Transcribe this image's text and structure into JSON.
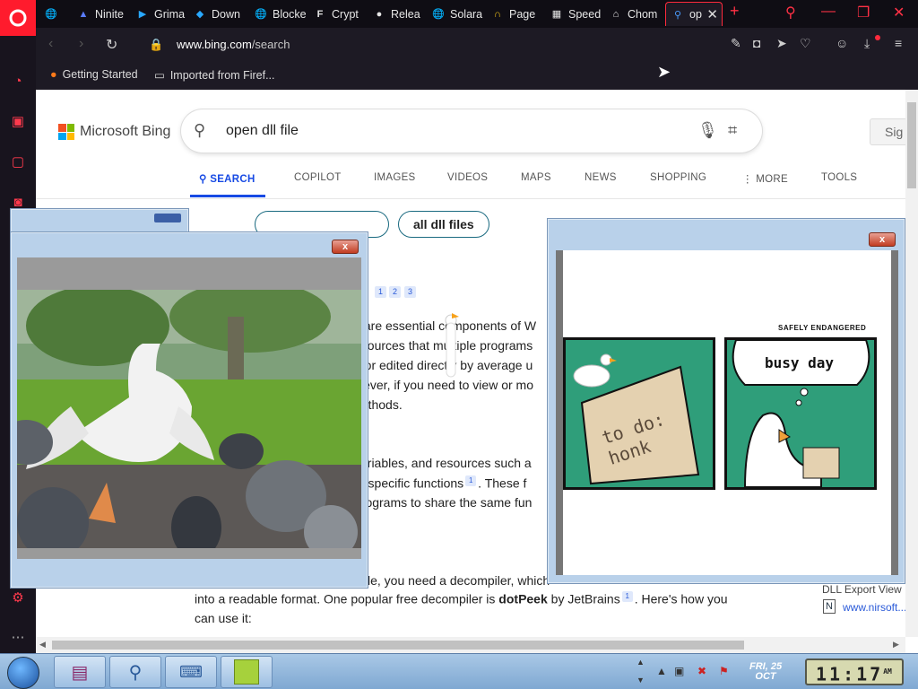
{
  "browser": {
    "tabs": [
      {
        "label": "",
        "icon": "globe-icon"
      },
      {
        "label": "Ninite",
        "icon": "ninite-icon"
      },
      {
        "label": "Grima",
        "icon": "play-icon"
      },
      {
        "label": "Down",
        "icon": "download-icon"
      },
      {
        "label": "Blocke",
        "icon": "globe-icon"
      },
      {
        "label": "Crypt",
        "icon": "f-icon"
      },
      {
        "label": "Relea",
        "icon": "github-icon"
      },
      {
        "label": "Solara",
        "icon": "globe-icon"
      },
      {
        "label": "Page",
        "icon": "headset-icon"
      },
      {
        "label": "Speed",
        "icon": "grid-icon"
      },
      {
        "label": "Chom",
        "icon": "bank-icon"
      },
      {
        "label": "op",
        "icon": "search-icon",
        "active": true
      }
    ],
    "url_domain": "www.bing.com",
    "url_path": "/search",
    "bookmarks": [
      {
        "label": "Getting Started",
        "icon": "firefox-icon"
      },
      {
        "label": "Imported from Firef...",
        "icon": "folder-icon"
      }
    ]
  },
  "bing": {
    "logo_text": "Microsoft Bing",
    "query": "open dll file",
    "sign_in": "Sig",
    "nav": [
      "SEARCH",
      "COPILOT",
      "IMAGES",
      "VIDEOS",
      "MAPS",
      "NEWS",
      "SHOPPING",
      "MORE",
      "TOOLS"
    ],
    "chips": [
      "",
      "all dll files"
    ],
    "citations": [
      "1",
      "2",
      "3"
    ],
    "lines": [
      "s are essential components of W",
      "esources that multiple programs",
      "d or edited directly by average u",
      "wever, if you need to view or mo",
      "nethods.",
      "variables, and resources such a",
      "m specific functions",
      ". These f",
      "programs to share the same fun",
      "le, you need a decompiler, which",
      "into a readable format. One popular free decompiler is ",
      "dotPeek",
      " by JetBrains",
      ". Here's how you",
      "can use it:"
    ],
    "sup": "1",
    "side": {
      "title": "DLL Export View",
      "url": "www.nirsoft..."
    }
  },
  "comic": {
    "credit": "SAFELY ENDANGERED",
    "panel1_note": "to do: honk",
    "panel2_title": "busy day"
  },
  "close_glyph": "x",
  "taskbar": {
    "date_day": "FRI, 25",
    "date_month": "OCT",
    "time": "11:17",
    "ampm": "AM"
  }
}
